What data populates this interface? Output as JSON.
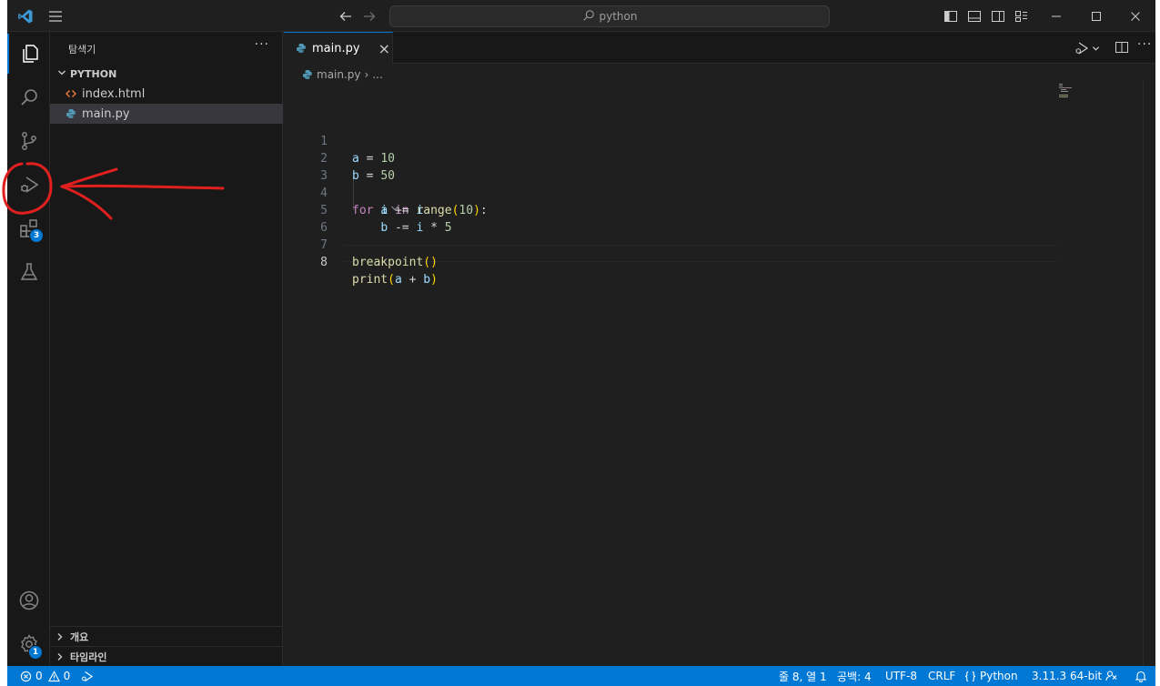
{
  "titlebar": {
    "search_text": "python"
  },
  "activitybar": {
    "extensions_badge": "3",
    "manage_badge": "1"
  },
  "sidebar": {
    "title": "탐색기",
    "more_label": "···",
    "folder_name": "PYTHON",
    "files": [
      {
        "name": "index.html",
        "icon": "html-file-icon"
      },
      {
        "name": "main.py",
        "icon": "python-file-icon",
        "selected": true
      }
    ],
    "bottom_sections": [
      "개요",
      "타임라인"
    ]
  },
  "editor": {
    "tab_label": "main.py",
    "tab_close": "×",
    "breadcrumb": {
      "file": "main.py",
      "separator": "›",
      "more": "..."
    },
    "line_numbers": [
      "1",
      "2",
      "3",
      "4",
      "5",
      "6",
      "7",
      "8"
    ],
    "active_line": 8
  },
  "statusbar": {
    "errors": "0",
    "warnings": "0",
    "cursor_position": "줄 8, 열 1",
    "indentation": "공백: 4",
    "encoding": "UTF-8",
    "line_ending": "CRLF",
    "language": "Python",
    "interpreter": "3.11.3 64-bit"
  },
  "colors": {
    "accent": "#0078d4",
    "annotation": "#e0201e",
    "keyword": "#c586c0",
    "function": "#dcdcaa",
    "variable": "#9cdcfe",
    "number": "#b5cea8"
  }
}
